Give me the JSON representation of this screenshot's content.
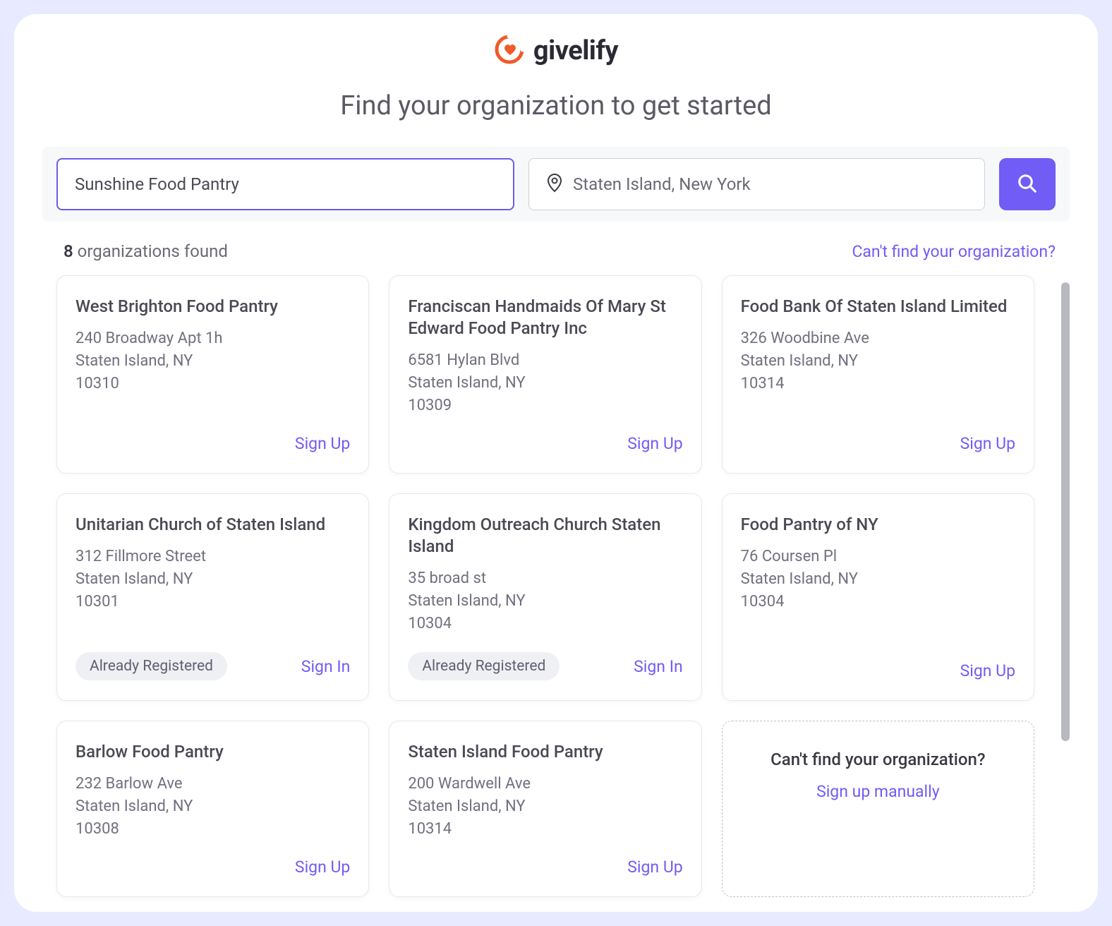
{
  "brand": {
    "name": "givelify"
  },
  "page": {
    "title": "Find your organization to get started"
  },
  "search": {
    "name_value": "Sunshine Food Pantry",
    "location_value": "Staten Island, New York"
  },
  "results": {
    "count": "8",
    "count_suffix": " organizations found",
    "cant_find_label": "Can't find your organization?"
  },
  "labels": {
    "sign_up": "Sign Up",
    "sign_in": "Sign In",
    "already_registered": "Already Registered"
  },
  "promo": {
    "title": "Can't find your organization?",
    "link": "Sign up manually"
  },
  "orgs": [
    {
      "name": "West Brighton Food Pantry",
      "address": "240 Broadway Apt 1h\nStaten Island, NY\n10310",
      "registered": false
    },
    {
      "name": "Franciscan Handmaids Of Mary St Edward Food Pantry Inc",
      "address": "6581 Hylan Blvd\nStaten Island, NY\n10309",
      "registered": false
    },
    {
      "name": "Food Bank Of Staten Island Limited",
      "address": "326 Woodbine Ave\nStaten Island, NY\n10314",
      "registered": false
    },
    {
      "name": "Unitarian Church of Staten Island",
      "address": "312 Fillmore Street\nStaten Island, NY\n10301",
      "registered": true
    },
    {
      "name": "Kingdom Outreach Church Staten Island",
      "address": "35 broad st\nStaten Island, NY\n10304",
      "registered": true
    },
    {
      "name": "Food Pantry of NY",
      "address": "76 Coursen Pl\nStaten Island, NY\n10304",
      "registered": false
    },
    {
      "name": "Barlow Food Pantry",
      "address": "232 Barlow Ave\nStaten Island, NY\n10308",
      "registered": false
    },
    {
      "name": "Staten Island Food Pantry",
      "address": "200 Wardwell Ave\nStaten Island, NY\n10314",
      "registered": false
    }
  ]
}
